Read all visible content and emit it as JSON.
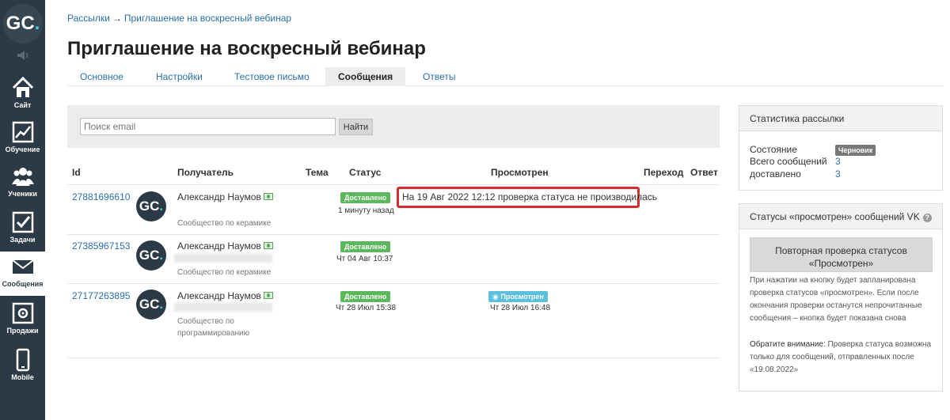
{
  "sidebar": {
    "logo": "GC",
    "logo_dot": ".",
    "items": [
      {
        "label": "Сайт"
      },
      {
        "label": "Обучение"
      },
      {
        "label": "Ученики"
      },
      {
        "label": "Задачи"
      },
      {
        "label": "Сообщения"
      },
      {
        "label": "Продажи"
      },
      {
        "label": "Mobile"
      }
    ]
  },
  "breadcrumb": {
    "parent": "Рассылки",
    "separator": "→",
    "current": "Приглашение на воскресный вебинар"
  },
  "page_title": "Приглашение на воскресный вебинар",
  "tabs": [
    "Основное",
    "Настройки",
    "Тестовое письмо",
    "Сообщения",
    "Ответы"
  ],
  "search": {
    "placeholder": "Поиск email",
    "button": "Найти"
  },
  "table": {
    "headers": [
      "Id",
      "Получатель",
      "Тема",
      "Статус",
      "Просмотрен",
      "Переход",
      "Ответ"
    ],
    "rows": [
      {
        "id": "27881696610",
        "avatar": "GC",
        "name": "Александр Наумов",
        "group": "Сообщество по керамике",
        "status": "Доставлено",
        "status_time": "1 минуту назад",
        "viewed_note": "На 19 Авг 2022 12:12 проверка статуса не производилась"
      },
      {
        "id": "27385967153",
        "avatar": "GC",
        "name": "Александр Наумов",
        "group": "Сообщество по керамике",
        "status": "Доставлено",
        "status_time": "Чт 04 Авг 10:37"
      },
      {
        "id": "27177263895",
        "avatar": "GC",
        "name": "Александр Наумов",
        "group_line1": "Сообщество по",
        "group_line2": "программированию",
        "status": "Доставлено",
        "status_time": "Чт 28 Июл 15:38",
        "viewed": "Просмотрен",
        "viewed_time": "Чт 28 Июл 16:48"
      }
    ]
  },
  "stats_panel": {
    "title": "Статистика рассылки",
    "state_label": "Состояние",
    "state_value": "Черновик",
    "total_label": "Всего сообщений",
    "total_value": "3",
    "delivered_label": "доставлено",
    "delivered_value": "3"
  },
  "vk_panel": {
    "title": "Статусы «просмотрен» сообщений VK",
    "help": "?",
    "button_line1": "Повторная проверка статусов",
    "button_line2": "«Просмотрен»",
    "info": "При нажатии на кнопку будет запланирована проверка статусов «просмотрен». Если после окончания проверки останутся непрочитанные сообщения – кнопка будет показана снова",
    "warning_label": "Обратите внимание:",
    "warning_text": " Проверка статуса возможна только для сообщений, отправленных после «19.08.2022»"
  },
  "colors": {
    "sidebar": "#2b3a46",
    "link": "#2a6fab",
    "success": "#5cb85c",
    "info": "#5bc0de",
    "highlight": "#d32f2f",
    "accent": "#3dd1c4"
  }
}
